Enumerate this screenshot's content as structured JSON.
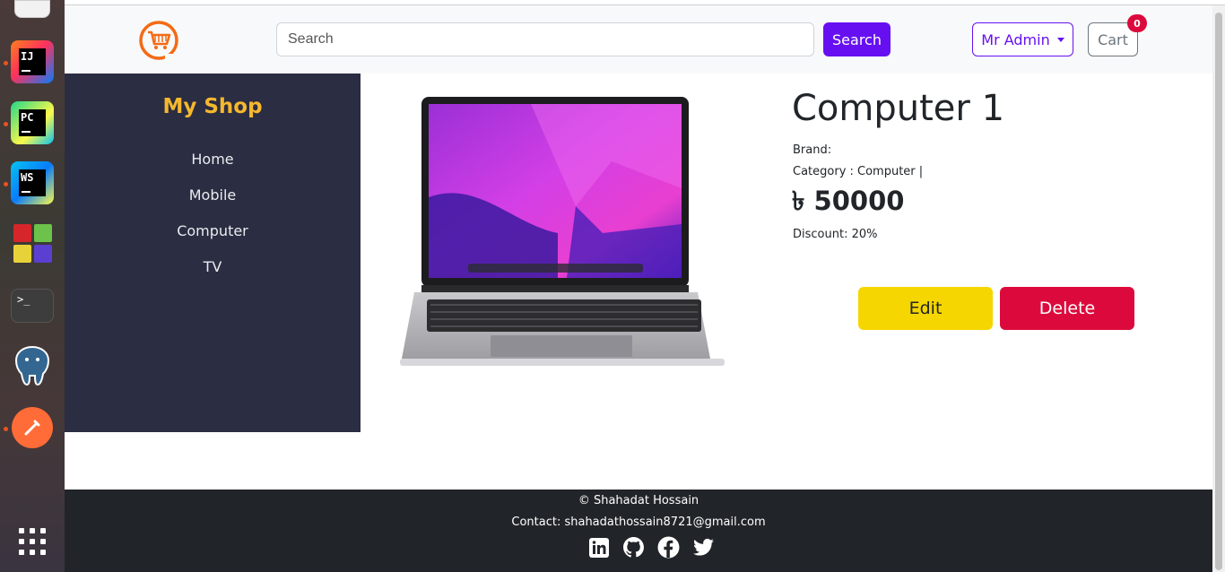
{
  "navbar": {
    "search_placeholder": "Search",
    "search_button": "Search",
    "user_menu": "Mr Admin",
    "cart_label": "Cart",
    "cart_count": "0"
  },
  "sidebar": {
    "title": "My Shop",
    "links": [
      "Home",
      "Mobile",
      "Computer",
      "TV"
    ]
  },
  "product": {
    "name": "Computer 1",
    "brand": "Brand:",
    "category": "Category : Computer |",
    "price": "৳ 50000",
    "discount": "Discount: 20%",
    "edit_label": "Edit",
    "delete_label": "Delete"
  },
  "footer": {
    "copyright": "© Shahadat Hossain",
    "contact": "Contact: shahadathossain8721@gmail.com",
    "socials": [
      "linkedin-icon",
      "github-icon",
      "facebook-icon",
      "twitter-icon"
    ]
  },
  "colors": {
    "accent": "#6610f2",
    "sidebar_bg": "#2b2d42",
    "shop_title": "#f5b82e",
    "edit": "#f5d600",
    "delete": "#dc0a3c",
    "footer_bg": "#212529"
  }
}
